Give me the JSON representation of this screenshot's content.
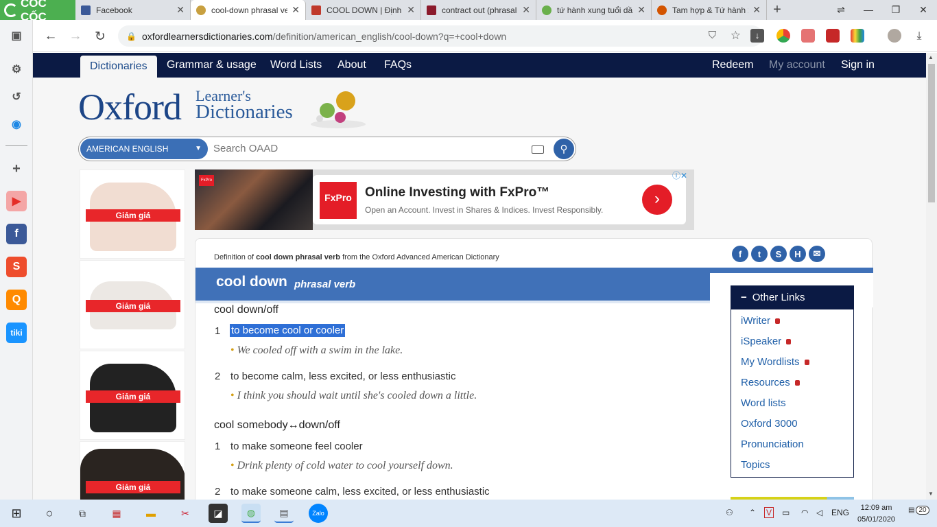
{
  "browser": {
    "brand": "CỐC CỐC",
    "tabs": [
      {
        "title": "Facebook",
        "color": "#3b5998",
        "active": false
      },
      {
        "title": "cool-down phrasal ve",
        "color": "#c8a040",
        "active": true
      },
      {
        "title": "COOL DOWN | Định ng",
        "color": "#c0392b",
        "active": false
      },
      {
        "title": "contract out (phrasal",
        "color": "#8b1a2b",
        "active": false
      },
      {
        "title": "tứ hành xung tuổi dầ",
        "color": "#6ab04c",
        "active": false
      },
      {
        "title": "Tam hợp & Tứ hành x",
        "color": "#d35400",
        "active": false
      }
    ],
    "url_host": "oxfordlearnersdictionaries.com",
    "url_path": "/definition/american_english/cool-down?q=+cool+down"
  },
  "site_nav": {
    "left": [
      "Dictionaries",
      "Grammar & usage",
      "Word Lists",
      "About",
      "FAQs"
    ],
    "right": [
      "Redeem",
      "My account",
      "Sign in"
    ]
  },
  "logo": {
    "main": "Oxford",
    "line1": "Learner's",
    "line2": "Dictionaries"
  },
  "search": {
    "dictionary": "AMERICAN ENGLISH",
    "placeholder": "Search OAAD"
  },
  "side_ads": {
    "sale_label": "Giảm giá"
  },
  "banner": {
    "brand": "FxPro",
    "headline": "Online Investing with FxPro™",
    "subline": "Open an Account. Invest in Shares & Indices. Invest Responsibly."
  },
  "entry": {
    "def_prefix": "Definition of",
    "def_term": "cool down phrasal verb",
    "def_suffix": "from the Oxford Advanced American Dictionary",
    "headword": "cool down",
    "pos": "phrasal verb",
    "groups": [
      {
        "pattern": "cool down/off",
        "senses": [
          {
            "num": "1",
            "def": "to become cool or cooler",
            "example": "We cooled off with a swim in the lake."
          },
          {
            "num": "2",
            "def": "to become calm, less excited, or less enthusiastic",
            "example": "I think you should wait until she's cooled down a little."
          }
        ]
      },
      {
        "pattern": "cool somebody↔down/off",
        "senses": [
          {
            "num": "1",
            "def": "to make someone feel cooler",
            "example": "Drink plenty of cold water to cool yourself down."
          },
          {
            "num": "2",
            "def": "to make someone calm, less excited, or less enthusiastic"
          }
        ]
      }
    ]
  },
  "other_links": {
    "title": "Other Links",
    "items": [
      "iWriter",
      "iSpeaker",
      "My Wordlists",
      "Resources",
      "Word lists",
      "Oxford 3000",
      "Pronunciation",
      "Topics"
    ]
  },
  "taskbar": {
    "lang": "ENG",
    "time": "12:09 am",
    "date": "05/01/2020",
    "notif": "20"
  }
}
